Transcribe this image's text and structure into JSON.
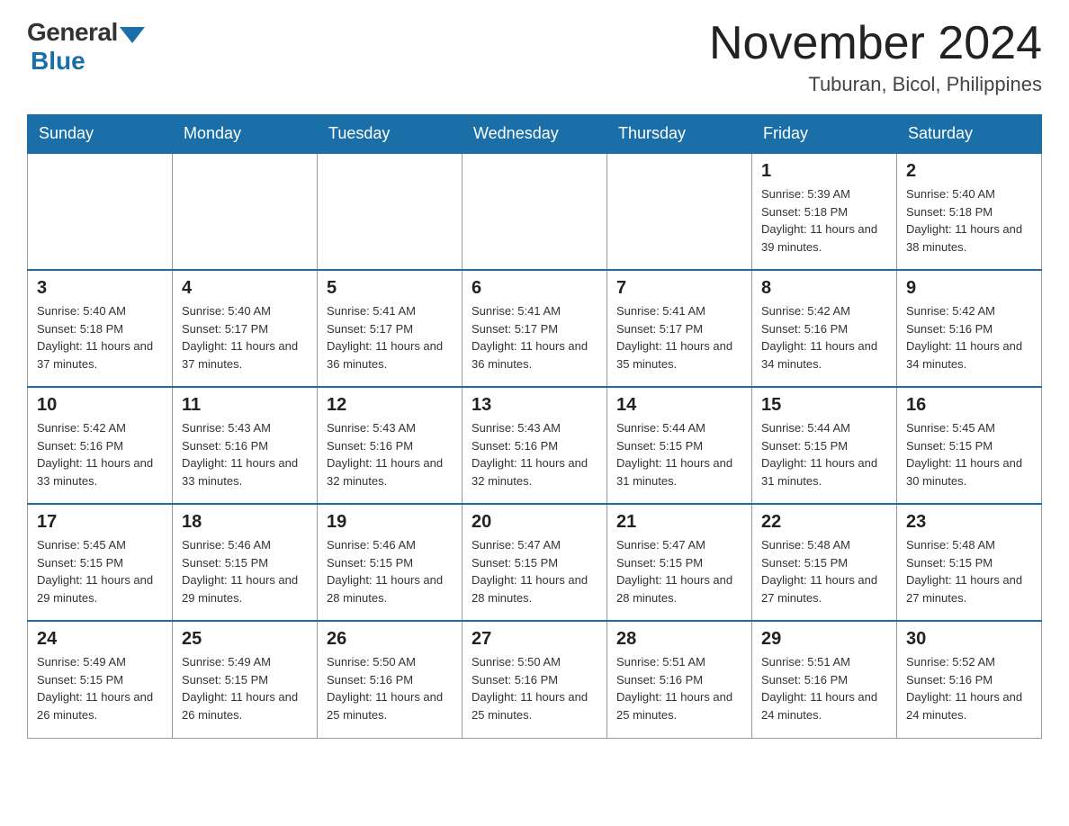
{
  "header": {
    "logo_general": "General",
    "logo_blue": "Blue",
    "month_title": "November 2024",
    "location": "Tuburan, Bicol, Philippines"
  },
  "calendar": {
    "days_of_week": [
      "Sunday",
      "Monday",
      "Tuesday",
      "Wednesday",
      "Thursday",
      "Friday",
      "Saturday"
    ],
    "weeks": [
      [
        {
          "day": "",
          "info": ""
        },
        {
          "day": "",
          "info": ""
        },
        {
          "day": "",
          "info": ""
        },
        {
          "day": "",
          "info": ""
        },
        {
          "day": "",
          "info": ""
        },
        {
          "day": "1",
          "info": "Sunrise: 5:39 AM\nSunset: 5:18 PM\nDaylight: 11 hours and 39 minutes."
        },
        {
          "day": "2",
          "info": "Sunrise: 5:40 AM\nSunset: 5:18 PM\nDaylight: 11 hours and 38 minutes."
        }
      ],
      [
        {
          "day": "3",
          "info": "Sunrise: 5:40 AM\nSunset: 5:18 PM\nDaylight: 11 hours and 37 minutes."
        },
        {
          "day": "4",
          "info": "Sunrise: 5:40 AM\nSunset: 5:17 PM\nDaylight: 11 hours and 37 minutes."
        },
        {
          "day": "5",
          "info": "Sunrise: 5:41 AM\nSunset: 5:17 PM\nDaylight: 11 hours and 36 minutes."
        },
        {
          "day": "6",
          "info": "Sunrise: 5:41 AM\nSunset: 5:17 PM\nDaylight: 11 hours and 36 minutes."
        },
        {
          "day": "7",
          "info": "Sunrise: 5:41 AM\nSunset: 5:17 PM\nDaylight: 11 hours and 35 minutes."
        },
        {
          "day": "8",
          "info": "Sunrise: 5:42 AM\nSunset: 5:16 PM\nDaylight: 11 hours and 34 minutes."
        },
        {
          "day": "9",
          "info": "Sunrise: 5:42 AM\nSunset: 5:16 PM\nDaylight: 11 hours and 34 minutes."
        }
      ],
      [
        {
          "day": "10",
          "info": "Sunrise: 5:42 AM\nSunset: 5:16 PM\nDaylight: 11 hours and 33 minutes."
        },
        {
          "day": "11",
          "info": "Sunrise: 5:43 AM\nSunset: 5:16 PM\nDaylight: 11 hours and 33 minutes."
        },
        {
          "day": "12",
          "info": "Sunrise: 5:43 AM\nSunset: 5:16 PM\nDaylight: 11 hours and 32 minutes."
        },
        {
          "day": "13",
          "info": "Sunrise: 5:43 AM\nSunset: 5:16 PM\nDaylight: 11 hours and 32 minutes."
        },
        {
          "day": "14",
          "info": "Sunrise: 5:44 AM\nSunset: 5:15 PM\nDaylight: 11 hours and 31 minutes."
        },
        {
          "day": "15",
          "info": "Sunrise: 5:44 AM\nSunset: 5:15 PM\nDaylight: 11 hours and 31 minutes."
        },
        {
          "day": "16",
          "info": "Sunrise: 5:45 AM\nSunset: 5:15 PM\nDaylight: 11 hours and 30 minutes."
        }
      ],
      [
        {
          "day": "17",
          "info": "Sunrise: 5:45 AM\nSunset: 5:15 PM\nDaylight: 11 hours and 29 minutes."
        },
        {
          "day": "18",
          "info": "Sunrise: 5:46 AM\nSunset: 5:15 PM\nDaylight: 11 hours and 29 minutes."
        },
        {
          "day": "19",
          "info": "Sunrise: 5:46 AM\nSunset: 5:15 PM\nDaylight: 11 hours and 28 minutes."
        },
        {
          "day": "20",
          "info": "Sunrise: 5:47 AM\nSunset: 5:15 PM\nDaylight: 11 hours and 28 minutes."
        },
        {
          "day": "21",
          "info": "Sunrise: 5:47 AM\nSunset: 5:15 PM\nDaylight: 11 hours and 28 minutes."
        },
        {
          "day": "22",
          "info": "Sunrise: 5:48 AM\nSunset: 5:15 PM\nDaylight: 11 hours and 27 minutes."
        },
        {
          "day": "23",
          "info": "Sunrise: 5:48 AM\nSunset: 5:15 PM\nDaylight: 11 hours and 27 minutes."
        }
      ],
      [
        {
          "day": "24",
          "info": "Sunrise: 5:49 AM\nSunset: 5:15 PM\nDaylight: 11 hours and 26 minutes."
        },
        {
          "day": "25",
          "info": "Sunrise: 5:49 AM\nSunset: 5:15 PM\nDaylight: 11 hours and 26 minutes."
        },
        {
          "day": "26",
          "info": "Sunrise: 5:50 AM\nSunset: 5:16 PM\nDaylight: 11 hours and 25 minutes."
        },
        {
          "day": "27",
          "info": "Sunrise: 5:50 AM\nSunset: 5:16 PM\nDaylight: 11 hours and 25 minutes."
        },
        {
          "day": "28",
          "info": "Sunrise: 5:51 AM\nSunset: 5:16 PM\nDaylight: 11 hours and 25 minutes."
        },
        {
          "day": "29",
          "info": "Sunrise: 5:51 AM\nSunset: 5:16 PM\nDaylight: 11 hours and 24 minutes."
        },
        {
          "day": "30",
          "info": "Sunrise: 5:52 AM\nSunset: 5:16 PM\nDaylight: 11 hours and 24 minutes."
        }
      ]
    ]
  }
}
